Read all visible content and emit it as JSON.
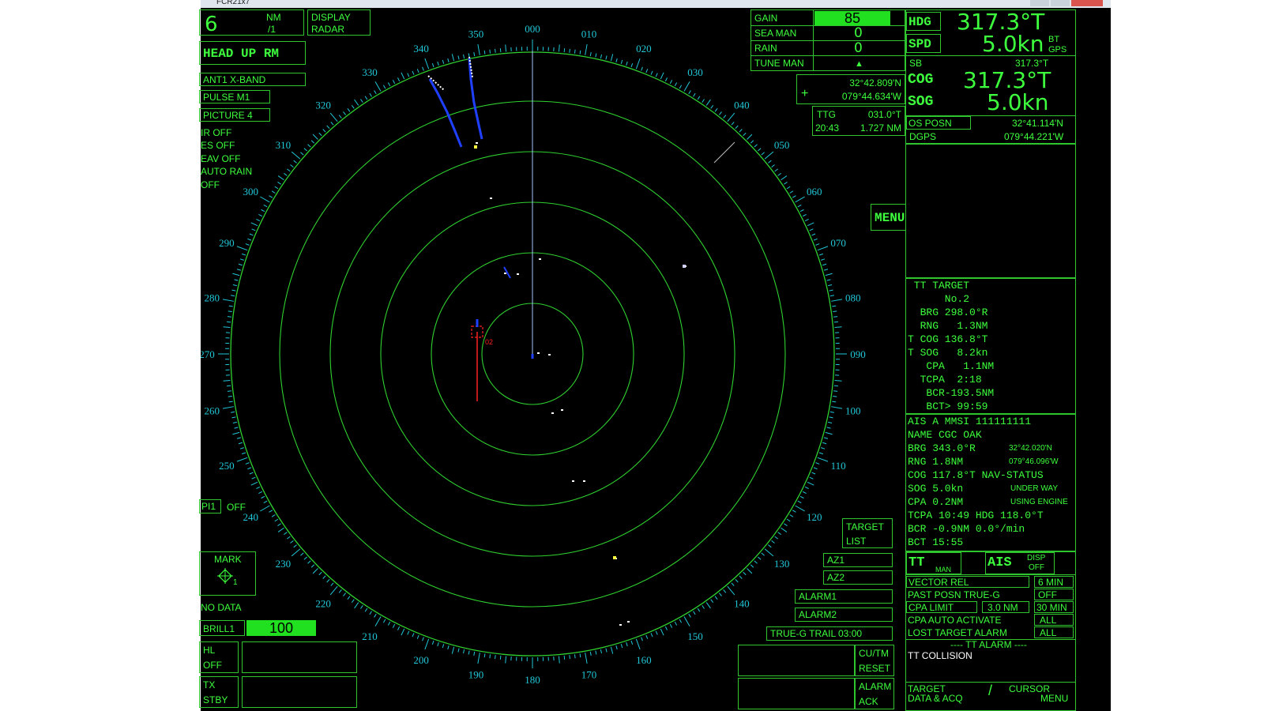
{
  "window": {
    "title": "FCR21x7"
  },
  "top_left": {
    "range": "6",
    "range_unit_1": "NM",
    "range_unit_2": "/1",
    "display_label_1": "DISPLAY",
    "display_label_2": "RADAR",
    "orientation": "HEAD UP RM",
    "antenna": "ANT1 X-BAND",
    "pulse": "PULSE M1",
    "picture": "PICTURE 4",
    "status_lines": [
      "IR OFF",
      "ES OFF",
      "EAV OFF",
      "AUTO RAIN",
      "OFF"
    ]
  },
  "gain_panel": {
    "gain_label": "GAIN",
    "gain_value": "85",
    "sea_label": "SEA MAN",
    "sea_value": "0",
    "rain_label": "RAIN",
    "rain_value": "0",
    "tune_label": "TUNE MAN",
    "tune_marker": "▲"
  },
  "cursor_readout": {
    "lat": "32°42.809'N",
    "lon": "079°44.634'W",
    "plus": "+"
  },
  "ttg": {
    "label": "TTG",
    "bearing": "031.0°T",
    "time": "20:43",
    "distance": "1.727 NM"
  },
  "menu_button": "MENU",
  "heading_panel": {
    "hdg_label": "HDG",
    "hdg_value": "317.3°T",
    "spd_label": "SPD",
    "spd_value": "5.0kn",
    "spd_src_1": "BT",
    "spd_src_2": "GPS",
    "sb_label": "SB",
    "sb_value": "317.3°T",
    "cog_label": "COG",
    "cog_value": "317.3°T",
    "sog_label": "SOG",
    "sog_value": "5.0kn",
    "os_posn_label": "OS POSN",
    "os_lat": "32°41.114'N",
    "dgps_label": "DGPS",
    "os_lon": "079°44.221'W"
  },
  "tt_target": {
    "lines": [
      " TT TARGET",
      "      No.2",
      "  BRG 298.0°R",
      "  RNG   1.3NM",
      "T COG 136.8°T",
      "T SOG   8.2kn",
      "   CPA   1.1NM",
      "  TCPA  2:18",
      "   BCR-193.5NM",
      "   BCT> 99:59"
    ]
  },
  "ais_target": {
    "header": "AIS A   MMSI 111111111",
    "name": "NAME CGC OAK",
    "brg": "BRG  343.0°R",
    "lat": "32°42.020'N",
    "rng": "RNG    1.8NM",
    "lon": "079°46.096'W",
    "cog": "COG 117.8°T NAV-STATUS",
    "sog": "SOG    5.0kn",
    "status_1": "UNDER WAY",
    "cpa": "CPA   0.2NM",
    "status_2": "USING ENGINE",
    "tcpa": "TCPA 10:49 HDG 118.0°T",
    "bcr": "BCR  -0.9NM   0.0°/min",
    "bct": "BCT  15:55"
  },
  "tt_ais_settings": {
    "tt_label": "TT",
    "tt_mode": "MAN",
    "ais_label": "AIS",
    "disp_label": "DISP",
    "disp_value": "OFF",
    "vector_label": "VECTOR REL",
    "vector_value": "6 MIN",
    "past_label": "PAST POSN TRUE-G",
    "past_value": "OFF",
    "cpa_limit_label": "CPA LIMIT",
    "cpa_limit_nm": "3.0 NM",
    "cpa_limit_min": "30 MIN",
    "cpa_auto_label": "CPA AUTO ACTIVATE",
    "cpa_auto_value": "ALL",
    "lost_label": "LOST TARGET ALARM",
    "lost_value": "ALL",
    "tt_alarm_header": "---- TT ALARM ----",
    "tt_alarm_text": "TT COLLISION",
    "target_data_1": "TARGET",
    "target_data_2": "DATA & ACQ",
    "slash": "/",
    "cursor_menu_1": "CURSOR",
    "cursor_menu_2": "MENU"
  },
  "bottom_left": {
    "pi_label": "PI1",
    "pi_value": "OFF",
    "mark_label": "MARK",
    "mark_num": "1",
    "no_data": "NO DATA",
    "brill_label": "BRILL1",
    "brill_value": "100",
    "hl_label": "HL",
    "hl_value": "OFF",
    "tx_label": "TX",
    "tx_value": "STBY"
  },
  "bottom_right": {
    "target_list_1": "TARGET",
    "target_list_2": "LIST",
    "az1": "AZ1",
    "az2": "AZ2",
    "alarm1": "ALARM1",
    "alarm2": "ALARM2",
    "trail": "TRUE-G TRAIL 03:00",
    "cutm_1": "CU/TM",
    "cutm_2": "RESET",
    "alarm_ack_1": "ALARM",
    "alarm_ack_2": "ACK"
  },
  "radar": {
    "bearing_labels": [
      "000",
      "010",
      "020",
      "030",
      "040",
      "050",
      "060",
      "070",
      "080",
      "090",
      "100",
      "110",
      "120",
      "130",
      "140",
      "150",
      "160",
      "170",
      "180",
      "190",
      "200",
      "210",
      "220",
      "230",
      "240",
      "250",
      "260",
      "270",
      "280",
      "290",
      "300",
      "310",
      "320",
      "330",
      "340",
      "350"
    ],
    "target_tag": "02",
    "colors": {
      "ring": "#2fd02f",
      "scale": "#20c8d8",
      "heading_line": "#a8c8ff",
      "ais": "#2040ff",
      "tt": "#ff2020"
    }
  }
}
